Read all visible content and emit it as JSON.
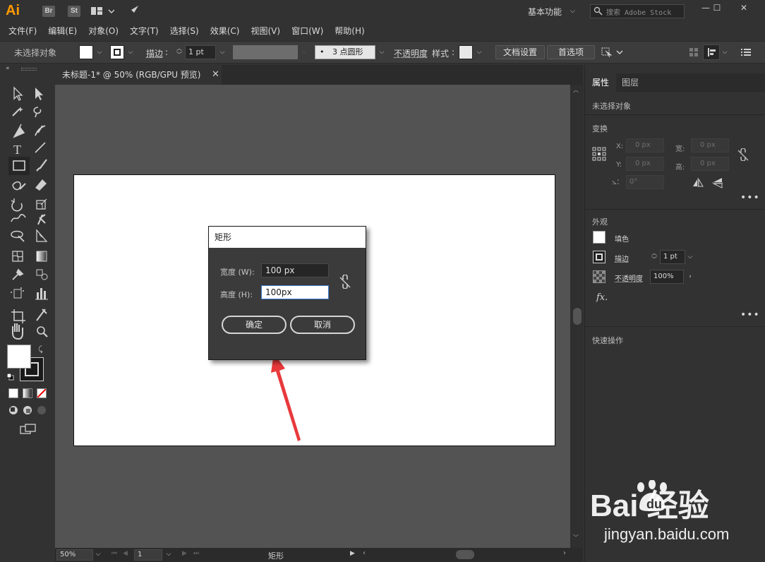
{
  "app": {
    "logo": "Ai",
    "br": "Br",
    "st": "St",
    "workspace": "基本功能",
    "search_placeholder": "搜索 Adobe Stock",
    "minimize": "—",
    "maximize": "☐",
    "close": "✕"
  },
  "menu": [
    "文件(F)",
    "编辑(E)",
    "对象(O)",
    "文字(T)",
    "选择(S)",
    "效果(C)",
    "视图(V)",
    "窗口(W)",
    "帮助(H)"
  ],
  "control": {
    "no_selection": "未选择对象",
    "stroke_label": "描边",
    "stroke_value": "1 pt",
    "brush": "3 点圆形",
    "opacity_label": "不透明度",
    "style_label": "样式",
    "doc_setup": "文档设置",
    "preferences": "首选项"
  },
  "document": {
    "tab_title": "未标题-1* @ 50% (RGB/GPU 预览)"
  },
  "dialog": {
    "title": "矩形",
    "width_label": "宽度 (W):",
    "width_value": "100 px",
    "height_label": "高度 (H):",
    "height_value": "100px",
    "ok": "确定",
    "cancel": "取消"
  },
  "status": {
    "zoom": "50%",
    "page": "1",
    "tool": "矩形"
  },
  "panel": {
    "tab_properties": "属性",
    "tab_layers": "图层",
    "no_selection": "未选择对象",
    "transform": "变换",
    "x": "X:",
    "y": "Y:",
    "w": "宽:",
    "h": "高:",
    "x_value": "0 px",
    "y_value": "0 px",
    "w_value": "0 px",
    "h_value": "0 px",
    "angle_value": "0°",
    "appearance": "外观",
    "fill": "填色",
    "stroke": "描边",
    "stroke_value": "1 pt",
    "opacity": "不透明度",
    "opacity_value": "100%",
    "fx": "fx.",
    "quick_actions": "快速操作"
  },
  "watermark": {
    "brand": "Bai  经验",
    "url": "jingyan.baidu.com"
  },
  "colors": {
    "accent": "#ff9a00",
    "arrow": "#e8393b",
    "focus": "#3a7bd5"
  }
}
